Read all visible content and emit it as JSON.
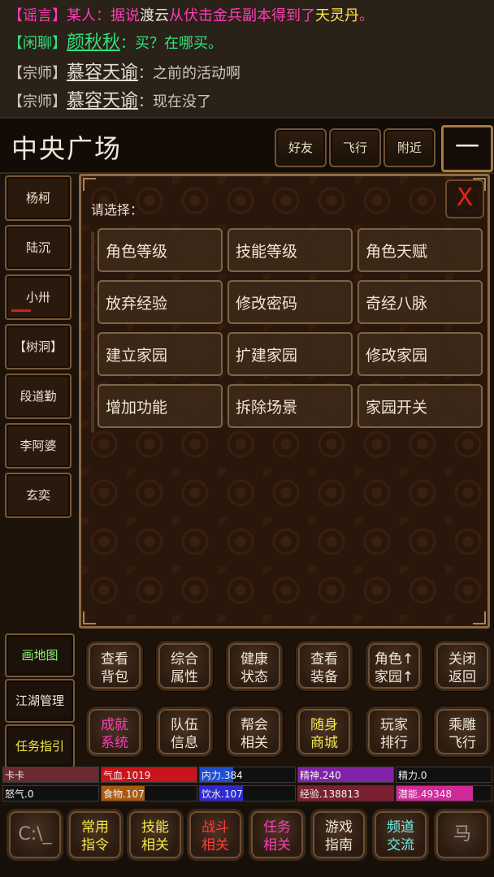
{
  "chat": [
    {
      "parts": [
        {
          "t": "【谣言】",
          "c": "c-pink"
        },
        {
          "t": "某人：据说",
          "c": "c-pink"
        },
        {
          "t": "渡云",
          "c": "c-white"
        },
        {
          "t": "从伏击金兵副本得到了",
          "c": "c-pink"
        },
        {
          "t": "天灵丹",
          "c": "c-yellow"
        },
        {
          "t": "。",
          "c": "c-pink"
        }
      ]
    },
    {
      "parts": [
        {
          "t": "【闲聊】",
          "c": "c-green"
        },
        {
          "t": "颜秋秋",
          "c": "name-ul green"
        },
        {
          "t": "：买？在哪买。",
          "c": "c-green"
        }
      ]
    },
    {
      "parts": [
        {
          "t": "【宗师】",
          "c": "c-gray"
        },
        {
          "t": "慕容天谕",
          "c": "name-ul white"
        },
        {
          "t": "：之前的活动啊",
          "c": "c-gray"
        }
      ]
    },
    {
      "parts": [
        {
          "t": "【宗师】",
          "c": "c-gray"
        },
        {
          "t": "慕容天谕",
          "c": "name-ul white"
        },
        {
          "t": "：现在没了",
          "c": "c-gray"
        }
      ]
    }
  ],
  "header": {
    "location": "中央广场",
    "buttons": [
      "好友",
      "飞行",
      "附近"
    ],
    "menu_label": "一"
  },
  "npcs": [
    "杨柯",
    "陆沉",
    "小卅",
    "【树洞】",
    "段道勤",
    "李阿婆",
    "玄奕"
  ],
  "dialog": {
    "close_label": "X",
    "prompt": "请选择：",
    "options": [
      "角色等级",
      "技能等级",
      "角色天赋",
      "放弃经验",
      "修改密码",
      "奇经八脉",
      "建立家园",
      "扩建家园",
      "修改家园",
      "增加功能",
      "拆除场景",
      "家园开关"
    ]
  },
  "left_buttons": [
    "画地图",
    "江湖管理",
    "任务指引"
  ],
  "actions_row1": [
    {
      "l1": "查看",
      "l2": "背包"
    },
    {
      "l1": "综合",
      "l2": "属性"
    },
    {
      "l1": "健康",
      "l2": "状态"
    },
    {
      "l1": "查看",
      "l2": "装备"
    },
    {
      "l1": "角色↑",
      "l2": "家园↑"
    },
    {
      "l1": "关闭",
      "l2": "返回"
    }
  ],
  "actions_row2": [
    {
      "l1": "成就",
      "l2": "系统",
      "color": "pink"
    },
    {
      "l1": "队伍",
      "l2": "信息",
      "color": ""
    },
    {
      "l1": "帮会",
      "l2": "相关",
      "color": ""
    },
    {
      "l1": "随身",
      "l2": "商城",
      "color": "yellow"
    },
    {
      "l1": "玩家",
      "l2": "排行",
      "color": ""
    },
    {
      "l1": "乘雕",
      "l2": "飞行",
      "color": ""
    }
  ],
  "stats_row1": [
    {
      "label": "卡卡",
      "fill": 1.0,
      "color": "#6b2a30"
    },
    {
      "label": "气血.1019",
      "fill": 1.0,
      "color": "#c8141c"
    },
    {
      "label": "内力.384",
      "fill": 0.35,
      "color": "#1f4fd0"
    },
    {
      "label": "精神.240",
      "fill": 1.0,
      "color": "#8222a8"
    },
    {
      "label": "精力.0",
      "fill": 0.0,
      "color": "#2a6a2a"
    }
  ],
  "stats_row2": [
    {
      "label": "怒气.0",
      "fill": 0.0,
      "color": "#7a2a2a"
    },
    {
      "label": "食物.107",
      "fill": 0.45,
      "color": "#a85a12"
    },
    {
      "label": "饮水.107",
      "fill": 0.45,
      "color": "#2e2ad0"
    },
    {
      "label": "经验.138813",
      "fill": 1.0,
      "color": "#7a2030"
    },
    {
      "label": "潜能.49348",
      "fill": 0.8,
      "color": "#d02a9a"
    }
  ],
  "bottom": [
    {
      "l1": "C:\\_",
      "l2": "",
      "color": "icon"
    },
    {
      "l1": "常用",
      "l2": "指令",
      "color": "yellow"
    },
    {
      "l1": "技能",
      "l2": "相关",
      "color": "yellow"
    },
    {
      "l1": "战斗",
      "l2": "相关",
      "color": "red"
    },
    {
      "l1": "任务",
      "l2": "相关",
      "color": "pink"
    },
    {
      "l1": "游戏",
      "l2": "指南",
      "color": ""
    },
    {
      "l1": "频道",
      "l2": "交流",
      "color": "cyan"
    },
    {
      "l1": "马",
      "l2": "",
      "color": "icon"
    }
  ],
  "colors": {
    "accent": "#a97a3f",
    "bg": "#1d120a",
    "close": "#e2231f"
  }
}
